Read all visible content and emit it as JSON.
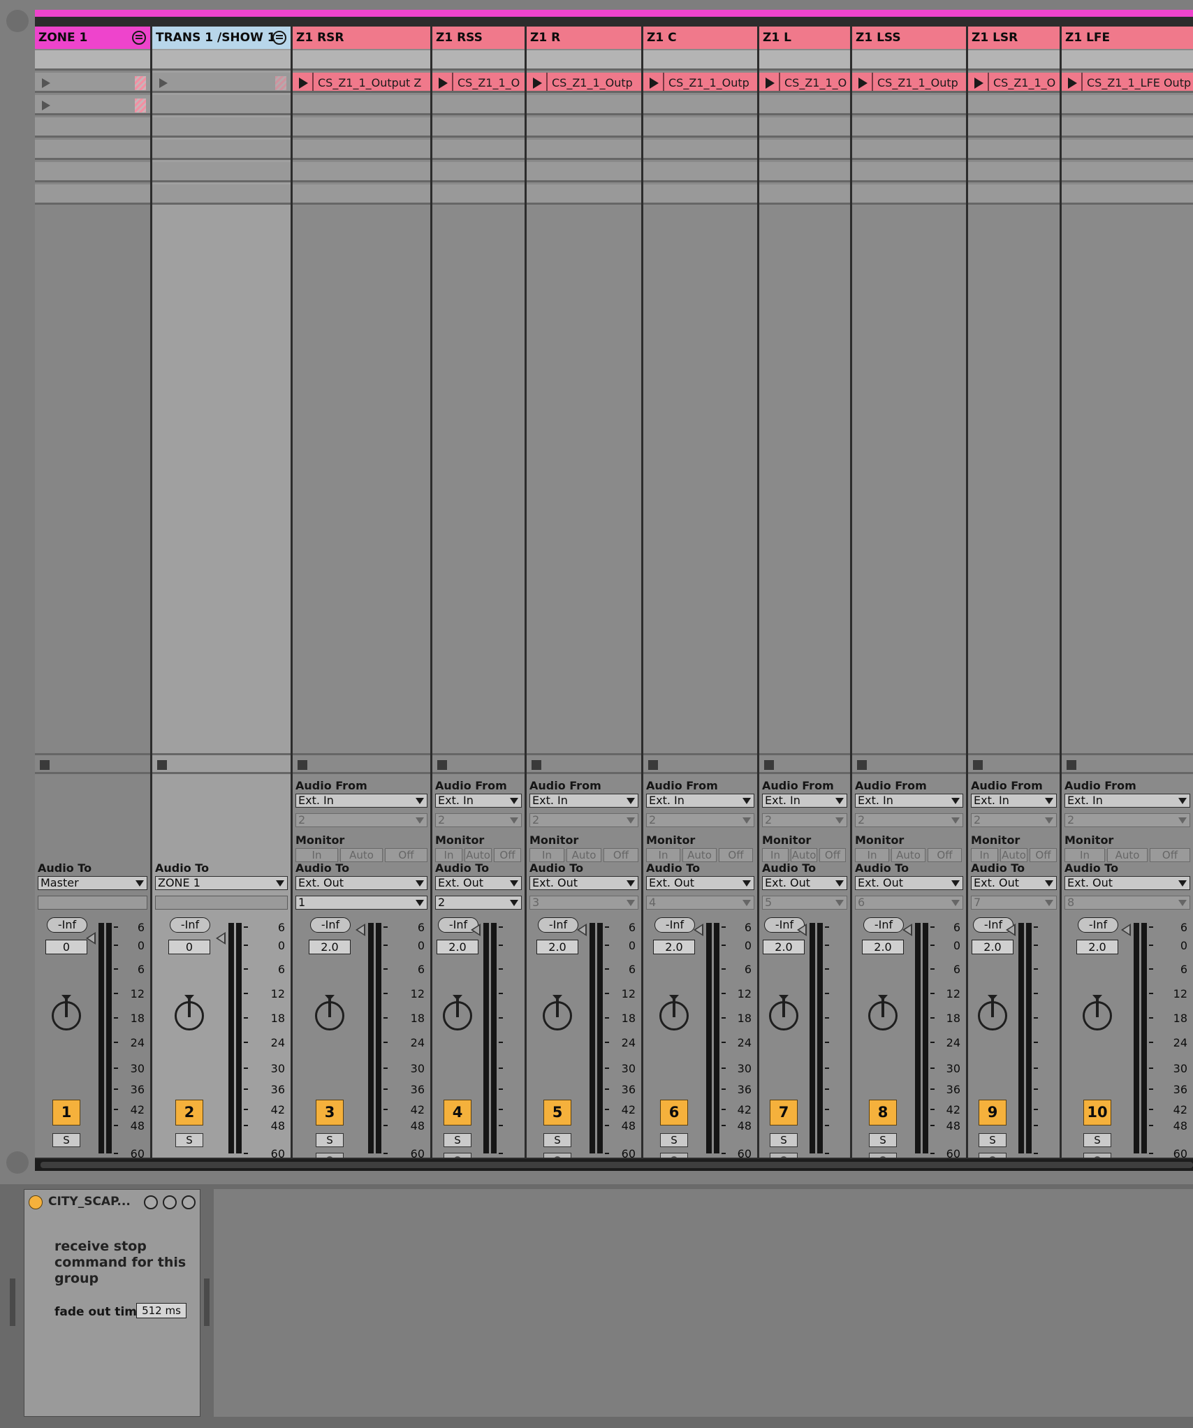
{
  "tracks": [
    {
      "name": "ZONE 1",
      "type": "group",
      "hdr_color": "#ee44cc",
      "has_group_icon": true,
      "clip": null,
      "slot1_empty": true,
      "slot2_empty": true,
      "audio_to": "Master",
      "audio_to_sub": "",
      "vol": "-Inf",
      "pan": "0",
      "num": "1",
      "solo": "S",
      "arm": false,
      "scale": "full"
    },
    {
      "name": "TRANS 1 /SHOW 1",
      "type": "sel",
      "hdr_color": "#b8d6ea",
      "has_group_icon": true,
      "clip": null,
      "slot1_empty": true,
      "slot2_empty": false,
      "audio_to": "ZONE 1",
      "audio_to_sub": "",
      "vol": "-Inf",
      "pan": "0",
      "num": "2",
      "solo": "S",
      "arm": false,
      "scale": "full"
    },
    {
      "name": "Z1 RSR",
      "clip": "CS_Z1_1_Output Z",
      "audio_from": "Ext. In",
      "from_sub": "2",
      "audio_to": "Ext. Out",
      "audio_to_sub": "1",
      "vol": "-Inf",
      "pan": "2.0",
      "num": "3",
      "solo": "S",
      "arm": true,
      "scale": "full"
    },
    {
      "name": "Z1 RSS",
      "clip": "CS_Z1_1_O",
      "audio_from": "Ext. In",
      "from_sub": "2",
      "audio_to": "Ext. Out",
      "audio_to_sub": "2",
      "vol": "-Inf",
      "pan": "2.0",
      "num": "4",
      "solo": "S",
      "arm": true,
      "scale": "ticks"
    },
    {
      "name": "Z1 R",
      "clip": "CS_Z1_1_Outp",
      "audio_from": "Ext. In",
      "from_sub": "2",
      "audio_to": "Ext. Out",
      "audio_to_sub": "3",
      "vol": "-Inf",
      "pan": "2.0",
      "num": "5",
      "solo": "S",
      "arm": true,
      "scale": "full"
    },
    {
      "name": "Z1 C",
      "clip": "CS_Z1_1_Outp",
      "audio_from": "Ext. In",
      "from_sub": "2",
      "audio_to": "Ext. Out",
      "audio_to_sub": "4",
      "vol": "-Inf",
      "pan": "2.0",
      "num": "6",
      "solo": "S",
      "arm": true,
      "scale": "full"
    },
    {
      "name": "Z1 L",
      "clip": "CS_Z1_1_O",
      "audio_from": "Ext. In",
      "from_sub": "2",
      "audio_to": "Ext. Out",
      "audio_to_sub": "5",
      "vol": "-Inf",
      "pan": "2.0",
      "num": "7",
      "solo": "S",
      "arm": true,
      "scale": "ticks"
    },
    {
      "name": "Z1 LSS",
      "clip": "CS_Z1_1_Outp",
      "audio_from": "Ext. In",
      "from_sub": "2",
      "audio_to": "Ext. Out",
      "audio_to_sub": "6",
      "vol": "-Inf",
      "pan": "2.0",
      "num": "8",
      "solo": "S",
      "arm": true,
      "scale": "full"
    },
    {
      "name": "Z1 LSR",
      "clip": "CS_Z1_1_O",
      "audio_from": "Ext. In",
      "from_sub": "2",
      "audio_to": "Ext. Out",
      "audio_to_sub": "7",
      "vol": "-Inf",
      "pan": "2.0",
      "num": "9",
      "solo": "S",
      "arm": true,
      "scale": "ticks"
    },
    {
      "name": "Z1 LFE",
      "clip": "CS_Z1_1_LFE Outp",
      "audio_from": "Ext. In",
      "from_sub": "2",
      "audio_to": "Ext. Out",
      "audio_to_sub": "8",
      "vol": "-Inf",
      "pan": "2.0",
      "num": "10",
      "solo": "S",
      "arm": true,
      "scale": "full"
    }
  ],
  "labels": {
    "audio_from": "Audio From",
    "monitor": "Monitor",
    "audio_to": "Audio To",
    "mon_in": "In",
    "mon_auto": "Auto",
    "mon_off": "Off"
  },
  "scale_values": [
    "6",
    "0",
    "6",
    "12",
    "18",
    "24",
    "30",
    "36",
    "42",
    "48",
    "60"
  ],
  "device": {
    "title": "CITY_SCAP...",
    "text": "receive stop command for this group",
    "fade_label": "fade out time",
    "fade_value": "512 ms"
  },
  "colors": {
    "clip": "#f0798b",
    "group": "#ee44cc",
    "selected": "#b8d6ea",
    "track_num": "#f5b13c",
    "device_dot": "#f5b13c"
  }
}
